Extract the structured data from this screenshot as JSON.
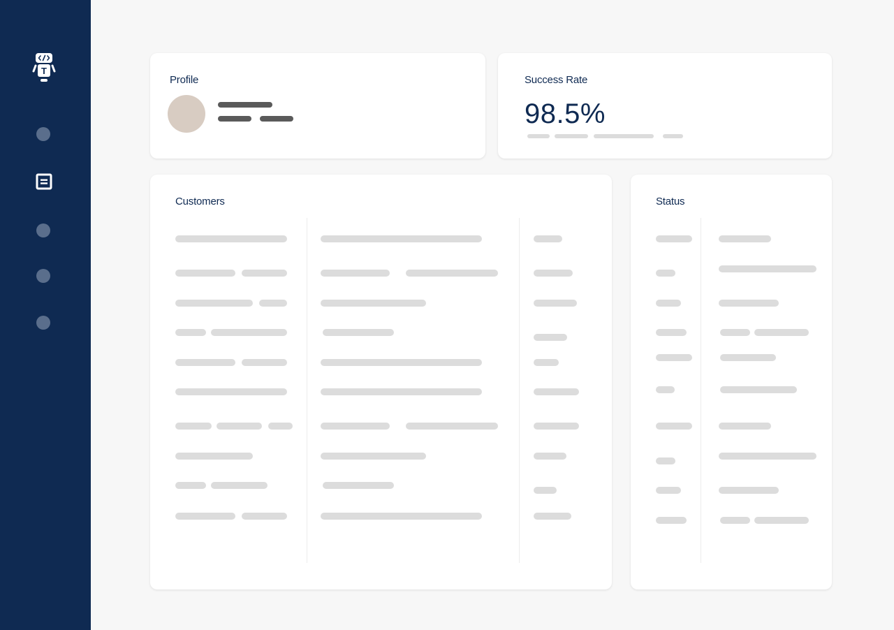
{
  "sidebar": {
    "logo_icon": "robot-code-icon",
    "logo_letter": "T",
    "nav": [
      {
        "icon": "nav-dot-icon"
      },
      {
        "icon": "document-list-icon",
        "active": true
      },
      {
        "icon": "nav-dot-icon"
      },
      {
        "icon": "nav-dot-icon"
      },
      {
        "icon": "nav-dot-icon"
      }
    ]
  },
  "profile": {
    "title": "Profile"
  },
  "success": {
    "title": "Success Rate",
    "value": "98.5%"
  },
  "customers": {
    "title": "Customers"
  },
  "status": {
    "title": "Status"
  },
  "colors": {
    "sidebar_bg": "#0f2a52",
    "page_bg": "#f7f7f7",
    "skeleton": "#dcdcdc",
    "accent_text": "#0f2a52",
    "avatar": "#d8ccc2"
  }
}
